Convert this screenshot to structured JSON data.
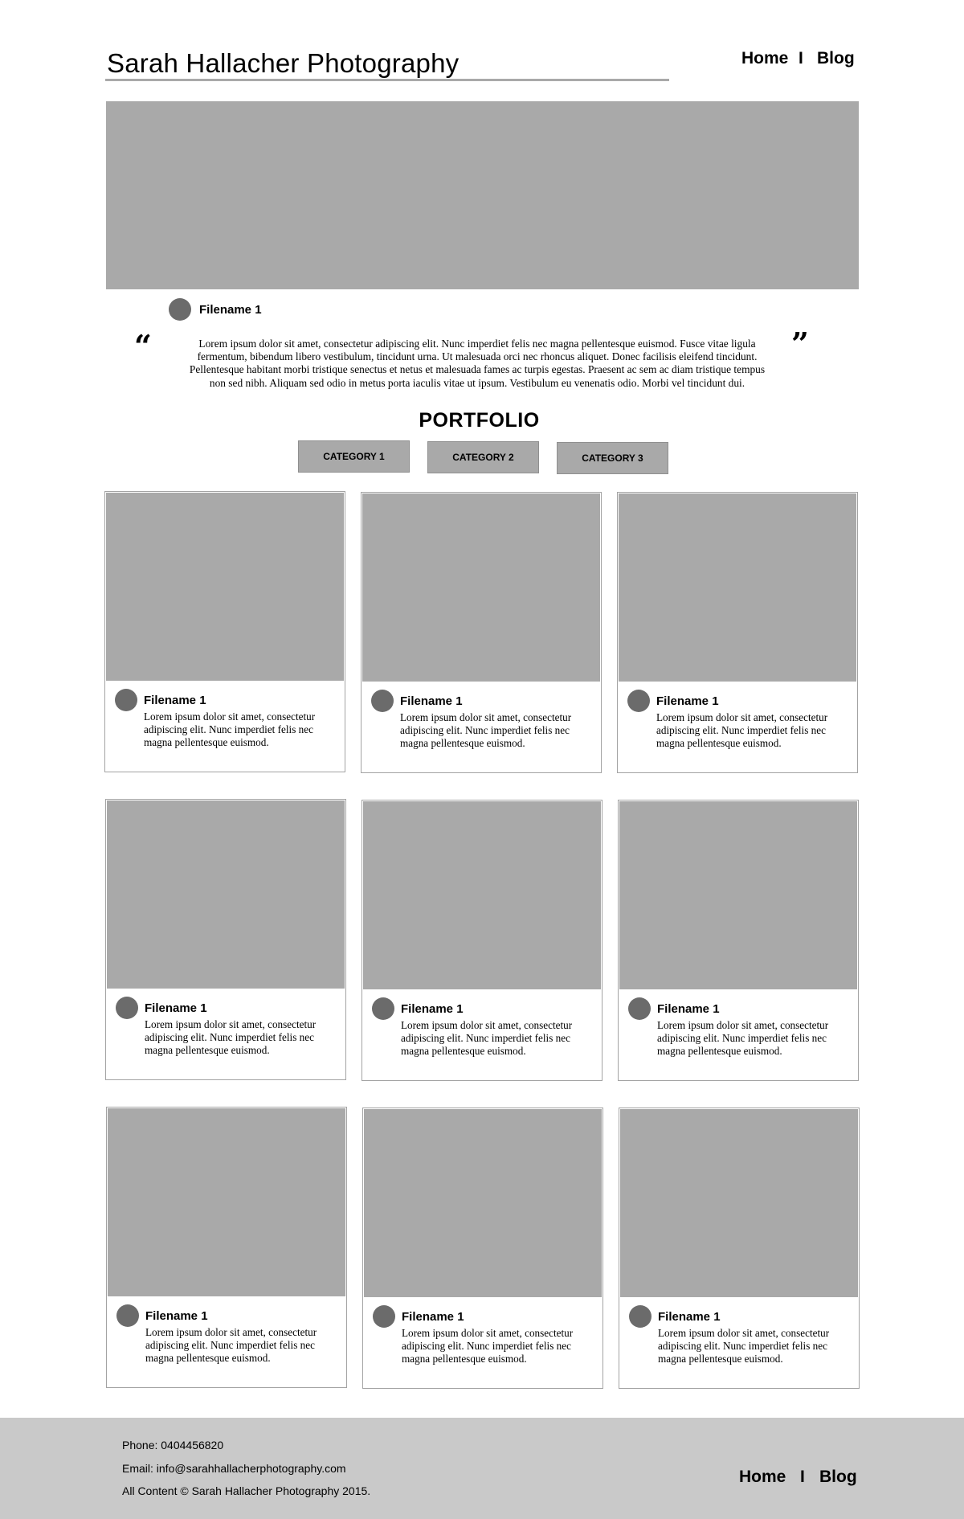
{
  "header": {
    "title": "Sarah Hallacher Photography",
    "nav": {
      "home": "Home",
      "separator": "I",
      "blog": "Blog"
    }
  },
  "featured": {
    "filename": "Filename 1",
    "open_quote": "“",
    "close_quote": "”",
    "quote": "Lorem ipsum dolor sit amet, consectetur adipiscing elit. Nunc imperdiet felis nec magna pellentesque euismod. Fusce vitae ligula fermentum, bibendum libero vestibulum, tincidunt urna. Ut malesuada orci nec rhoncus aliquet. Donec facilisis eleifend tincidunt. Pellentesque habitant morbi tristique senectus et netus et malesuada fames ac turpis egestas. Praesent ac sem ac diam tristique tempus non sed nibh. Aliquam sed odio in metus porta iaculis vitae ut ipsum. Vestibulum eu venenatis odio. Morbi vel tincidunt dui."
  },
  "portfolio": {
    "heading": "PORTFOLIO",
    "categories": [
      "CATEGORY 1",
      "CATEGORY 2",
      "CATEGORY 3"
    ],
    "cards": [
      {
        "title": "Filename 1",
        "desc": "Lorem ipsum dolor sit amet, consectetur adipiscing elit. Nunc imperdiet felis nec magna pellentesque euismod."
      },
      {
        "title": "Filename 1",
        "desc": "Lorem ipsum dolor sit amet, consectetur adipiscing elit. Nunc imperdiet felis nec magna pellentesque euismod."
      },
      {
        "title": "Filename 1",
        "desc": "Lorem ipsum dolor sit amet, consectetur adipiscing elit. Nunc imperdiet felis nec magna pellentesque euismod."
      },
      {
        "title": "Filename 1",
        "desc": "Lorem ipsum dolor sit amet, consectetur adipiscing elit. Nunc imperdiet felis nec magna pellentesque euismod."
      },
      {
        "title": "Filename 1",
        "desc": "Lorem ipsum dolor sit amet, consectetur adipiscing elit. Nunc imperdiet felis nec magna pellentesque euismod."
      },
      {
        "title": "Filename 1",
        "desc": "Lorem ipsum dolor sit amet, consectetur adipiscing elit. Nunc imperdiet felis nec magna pellentesque euismod."
      },
      {
        "title": "Filename 1",
        "desc": "Lorem ipsum dolor sit amet, consectetur adipiscing elit. Nunc imperdiet felis nec magna pellentesque euismod."
      },
      {
        "title": "Filename 1",
        "desc": "Lorem ipsum dolor sit amet, consectetur adipiscing elit. Nunc imperdiet felis nec magna pellentesque euismod."
      },
      {
        "title": "Filename 1",
        "desc": "Lorem ipsum dolor sit amet, consectetur adipiscing elit. Nunc imperdiet felis nec magna pellentesque euismod."
      }
    ]
  },
  "footer": {
    "phone": "Phone: 0404456820",
    "email": "Email: info@sarahhallacherphotography.com",
    "copyright": "All Content © Sarah Hallacher Photography 2015.",
    "nav": {
      "home": "Home",
      "separator": "I",
      "blog": "Blog"
    }
  },
  "colors": {
    "placeholder_gray": "#a9a9a9",
    "avatar_gray": "#6b6b6b",
    "footer_bg": "#c9c9c9"
  }
}
